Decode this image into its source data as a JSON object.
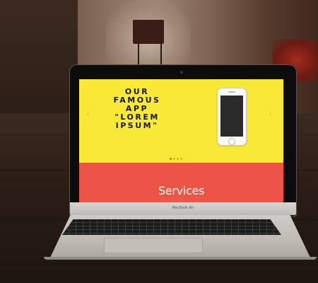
{
  "slider": {
    "title": "OUR\nFAMOUS\nAPP\n\"LOREM\nIPSUM\"",
    "prev_arrow": "‹",
    "next_arrow": "›",
    "dot_count": 4,
    "active_dot": 0
  },
  "services": {
    "title": "Services"
  },
  "laptop": {
    "brand": "MacBook Air"
  },
  "colors": {
    "slide_bg": "#f9e937",
    "services_bg": "#ec5545",
    "title_text": "#151515",
    "services_text": "#ffffff"
  }
}
